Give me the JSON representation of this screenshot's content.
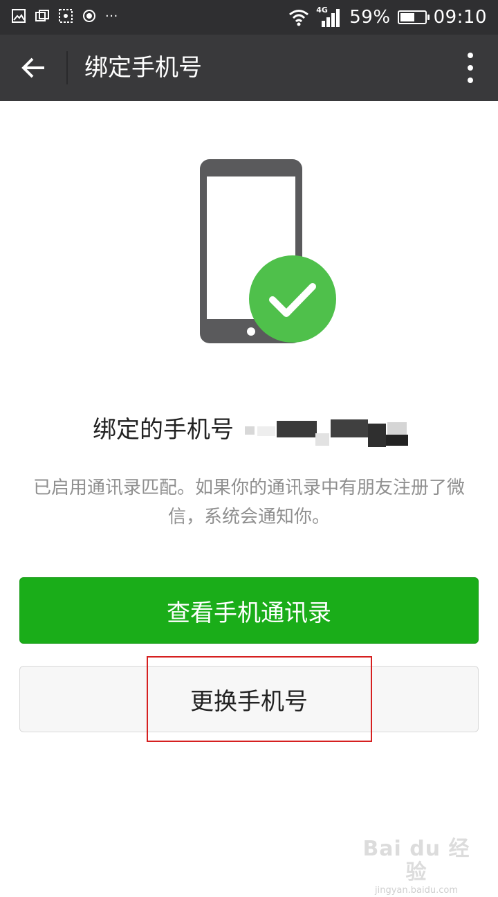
{
  "status_bar": {
    "icons_left": [
      "image-icon",
      "gallery-icon",
      "screenshot-icon",
      "record-icon",
      "more-notifications-icon"
    ],
    "overflow": "···",
    "network": "4G",
    "battery_percent": "59%",
    "battery_level": 0.59,
    "time": "09:10"
  },
  "header": {
    "title": "绑定手机号"
  },
  "main": {
    "bound_label": "绑定的手机号",
    "description": "已启用通讯录匹配。如果你的通讯录中有朋友注册了微信，系统会通知你。",
    "primary_button": "查看手机通讯录",
    "secondary_button": "更换手机号"
  },
  "colors": {
    "accent_green": "#1aad19",
    "check_green": "#4fc04b",
    "highlight_red": "#d62020",
    "titlebar": "#39393b"
  },
  "watermark": {
    "logo": "Bai du 经验",
    "url": "jingyan.baidu.com"
  }
}
